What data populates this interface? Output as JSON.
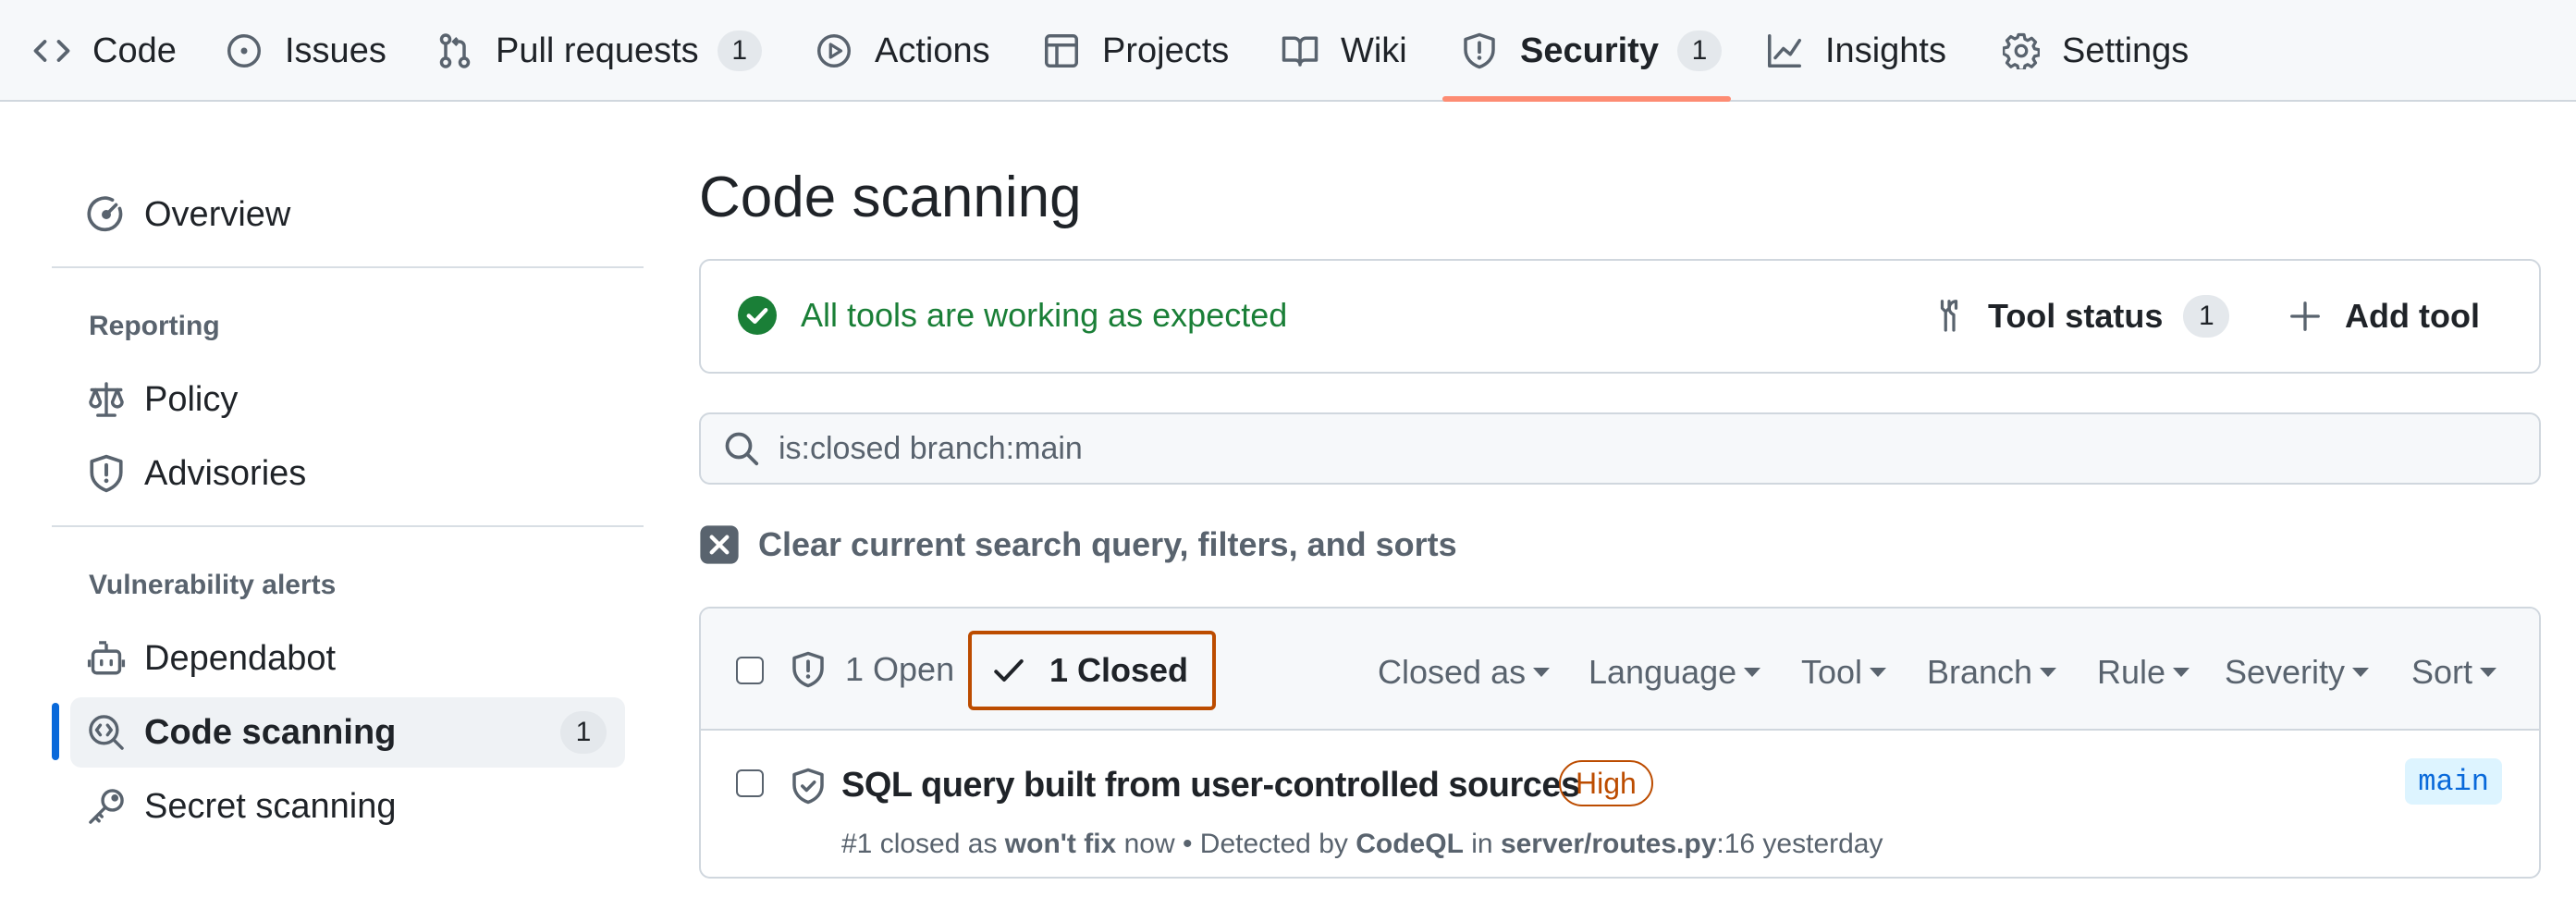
{
  "nav": {
    "tabs": [
      {
        "label": "Code",
        "icon": "code-icon"
      },
      {
        "label": "Issues",
        "icon": "issue-icon"
      },
      {
        "label": "Pull requests",
        "icon": "pull-request-icon",
        "count": "1"
      },
      {
        "label": "Actions",
        "icon": "play-icon"
      },
      {
        "label": "Projects",
        "icon": "table-icon"
      },
      {
        "label": "Wiki",
        "icon": "book-icon"
      },
      {
        "label": "Security",
        "icon": "shield-icon",
        "count": "1",
        "selected": true
      },
      {
        "label": "Insights",
        "icon": "graph-icon"
      },
      {
        "label": "Settings",
        "icon": "gear-icon"
      }
    ],
    "selected_underline_color": "#fd8c73"
  },
  "sidebar": {
    "overview": "Overview",
    "reporting_heading": "Reporting",
    "policy": "Policy",
    "advisories": "Advisories",
    "vuln_heading": "Vulnerability alerts",
    "dependabot": "Dependabot",
    "code_scanning": "Code scanning",
    "code_scanning_count": "1",
    "secret_scanning": "Secret scanning",
    "selected_accent": "#0969da"
  },
  "main": {
    "title": "Code scanning",
    "status_message": "All tools are working as expected",
    "status_color": "#1a7f37",
    "tool_status_label": "Tool status",
    "tool_status_count": "1",
    "add_tool_label": "Add tool",
    "search_value": "is:closed branch:main",
    "clear_query_label": "Clear current search query, filters, and sorts",
    "open_filter": "1 Open",
    "closed_filter": "1 Closed",
    "filters": [
      "Closed as",
      "Language",
      "Tool",
      "Branch",
      "Rule",
      "Severity",
      "Sort"
    ],
    "alert": {
      "title": "SQL query built from user-controlled sources",
      "severity": "High",
      "severity_color": "#bc4c00",
      "branch": "main",
      "meta_prefix": "#1 closed as ",
      "meta_reason": "won't fix",
      "meta_when": " now • Detected by ",
      "meta_tool": "CodeQL",
      "meta_in": " in ",
      "meta_file": "server/routes.py",
      "meta_line": ":16 yesterday"
    }
  }
}
